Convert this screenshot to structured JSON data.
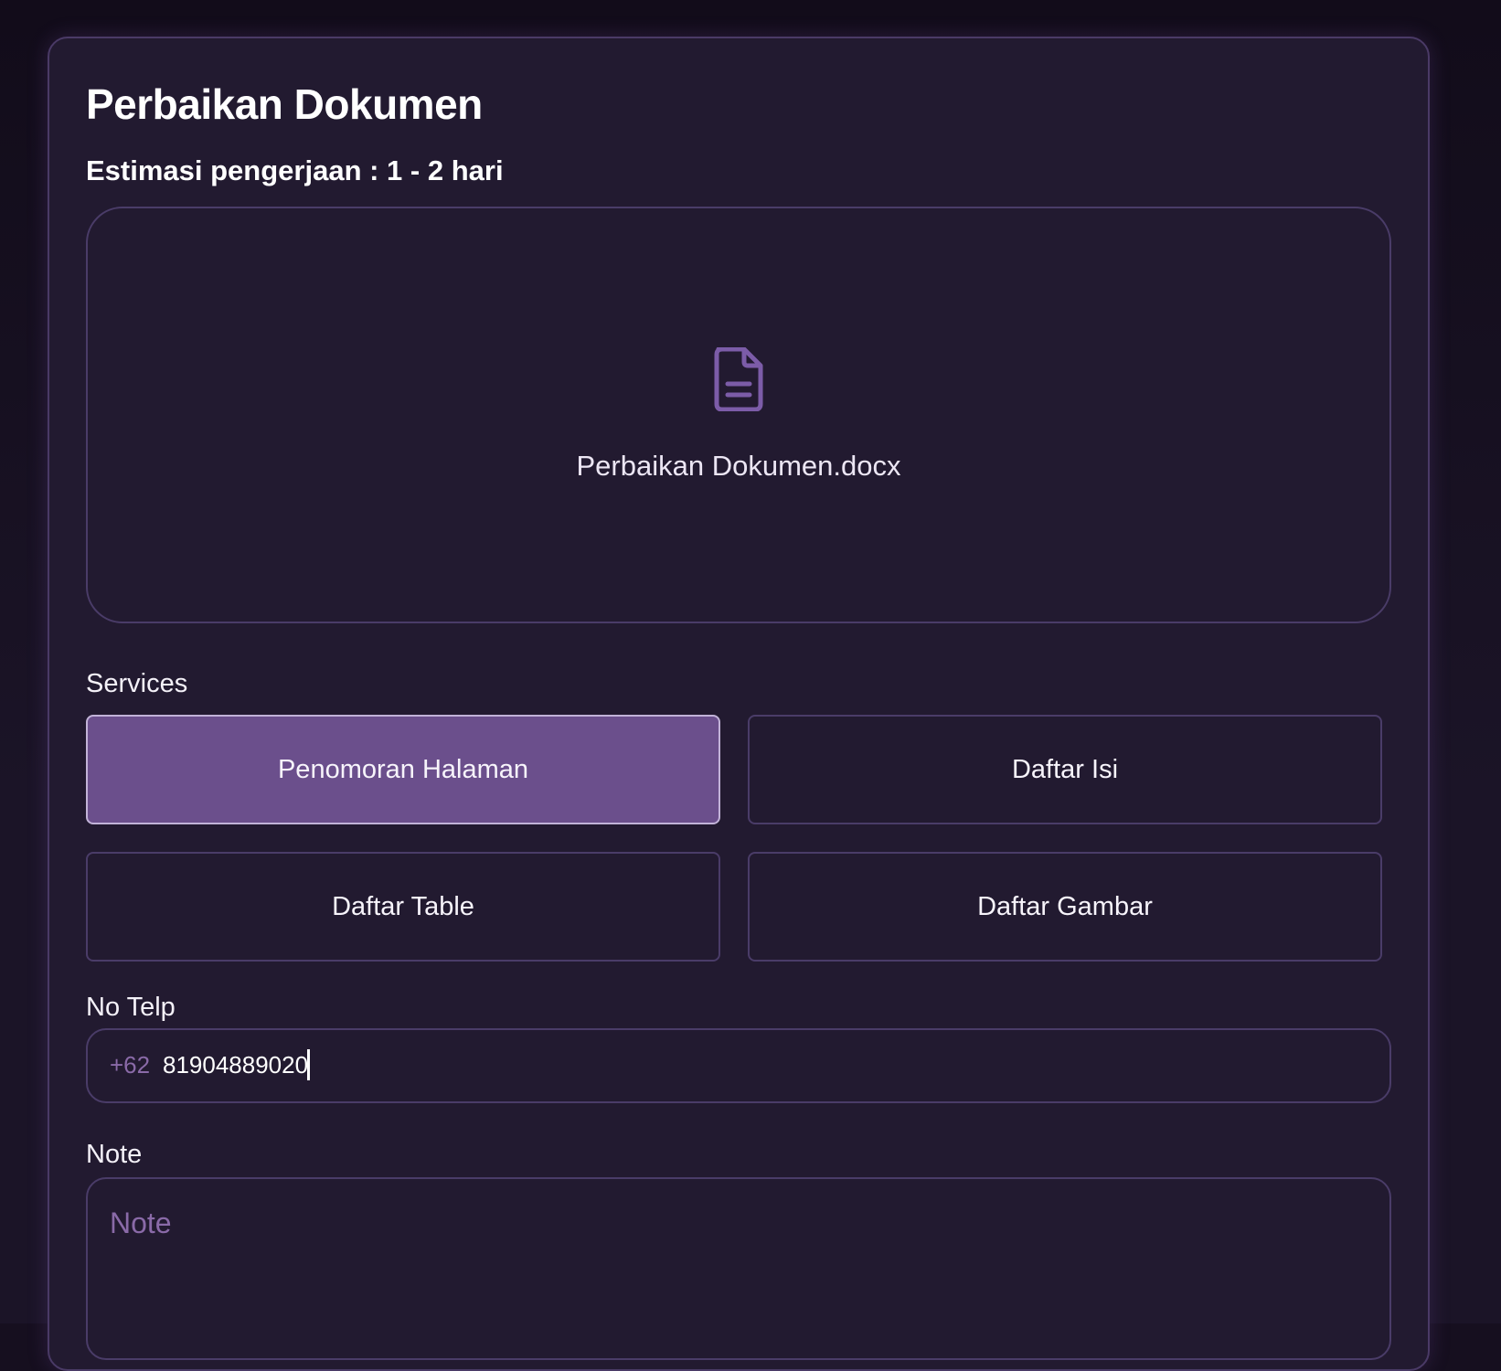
{
  "form": {
    "title": "Perbaikan Dokumen",
    "estimate": "Estimasi pengerjaan : 1 - 2 hari"
  },
  "upload": {
    "file_name": "Perbaikan Dokumen.docx",
    "icon": "document-icon"
  },
  "services": {
    "label": "Services",
    "options": [
      {
        "label": "Penomoran Halaman",
        "selected": true
      },
      {
        "label": "Daftar Isi",
        "selected": false
      },
      {
        "label": "Daftar Table",
        "selected": false
      },
      {
        "label": "Daftar Gambar",
        "selected": false
      }
    ]
  },
  "phone": {
    "label": "No Telp",
    "prefix": "+62",
    "value": "81904889020"
  },
  "note": {
    "label": "Note",
    "placeholder": "Note"
  },
  "colors": {
    "background": "#160f1f",
    "card": "#221a30",
    "border": "#4a3c68",
    "accent": "#6b4f8c",
    "muted_text": "#8a6aa8"
  }
}
